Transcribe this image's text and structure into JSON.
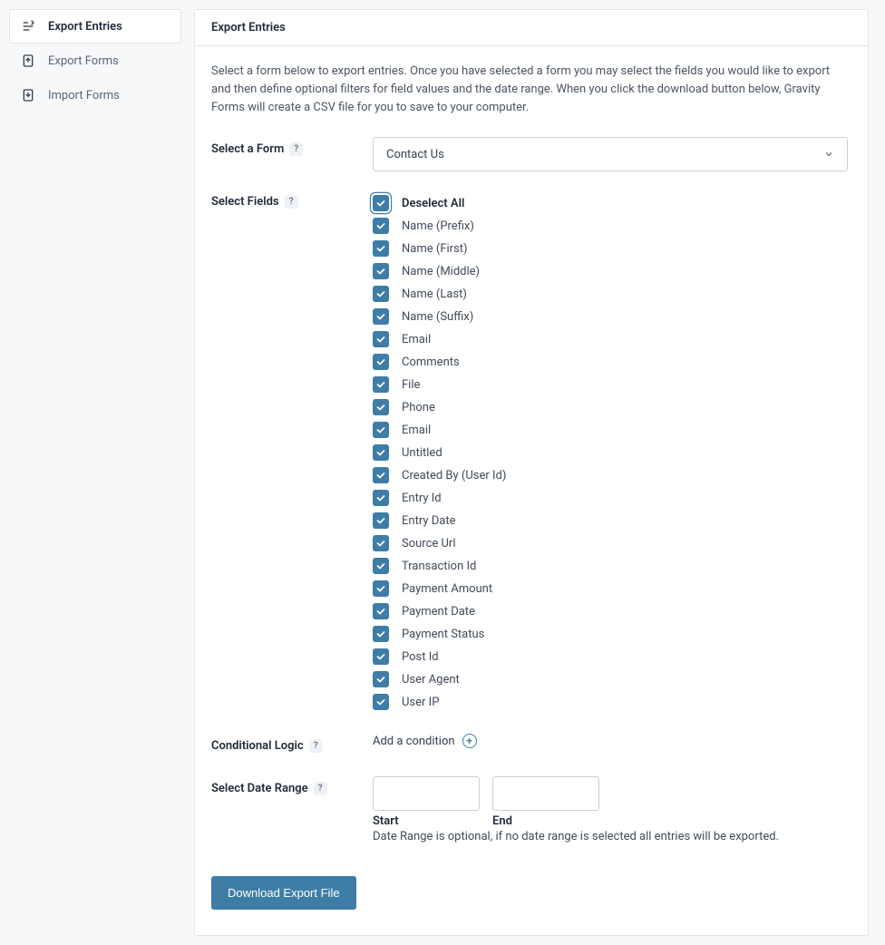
{
  "sidebar": {
    "items": [
      {
        "label": "Export Entries",
        "active": true,
        "icon": "export-entries-icon"
      },
      {
        "label": "Export Forms",
        "active": false,
        "icon": "export-forms-icon"
      },
      {
        "label": "Import Forms",
        "active": false,
        "icon": "import-forms-icon"
      }
    ]
  },
  "header": {
    "title": "Export Entries"
  },
  "description": "Select a form below to export entries. Once you have selected a form you may select the fields you would like to export and then define optional filters for field values and the date range. When you click the download button below, Gravity Forms will create a CSV file for you to save to your computer.",
  "labels": {
    "select_form": "Select a Form",
    "select_fields": "Select Fields",
    "conditional_logic": "Conditional Logic",
    "select_date_range": "Select Date Range",
    "help": "?"
  },
  "form_select": {
    "value": "Contact Us"
  },
  "fields": {
    "select_all_label": "Deselect All",
    "select_all_checked": true,
    "items": [
      {
        "label": "Name (Prefix)",
        "checked": true
      },
      {
        "label": "Name (First)",
        "checked": true
      },
      {
        "label": "Name (Middle)",
        "checked": true
      },
      {
        "label": "Name (Last)",
        "checked": true
      },
      {
        "label": "Name (Suffix)",
        "checked": true
      },
      {
        "label": "Email",
        "checked": true
      },
      {
        "label": "Comments",
        "checked": true
      },
      {
        "label": "File",
        "checked": true
      },
      {
        "label": "Phone",
        "checked": true
      },
      {
        "label": "Email",
        "checked": true
      },
      {
        "label": "Untitled",
        "checked": true
      },
      {
        "label": "Created By (User Id)",
        "checked": true
      },
      {
        "label": "Entry Id",
        "checked": true
      },
      {
        "label": "Entry Date",
        "checked": true
      },
      {
        "label": "Source Url",
        "checked": true
      },
      {
        "label": "Transaction Id",
        "checked": true
      },
      {
        "label": "Payment Amount",
        "checked": true
      },
      {
        "label": "Payment Date",
        "checked": true
      },
      {
        "label": "Payment Status",
        "checked": true
      },
      {
        "label": "Post Id",
        "checked": true
      },
      {
        "label": "User Agent",
        "checked": true
      },
      {
        "label": "User IP",
        "checked": true
      }
    ]
  },
  "conditional": {
    "add_label": "Add a condition"
  },
  "date_range": {
    "start_value": "",
    "end_value": "",
    "start_label": "Start",
    "end_label": "End",
    "note": "Date Range is optional, if no date range is selected all entries will be exported."
  },
  "download_button": "Download Export File",
  "colors": {
    "accent": "#3e7da6"
  }
}
